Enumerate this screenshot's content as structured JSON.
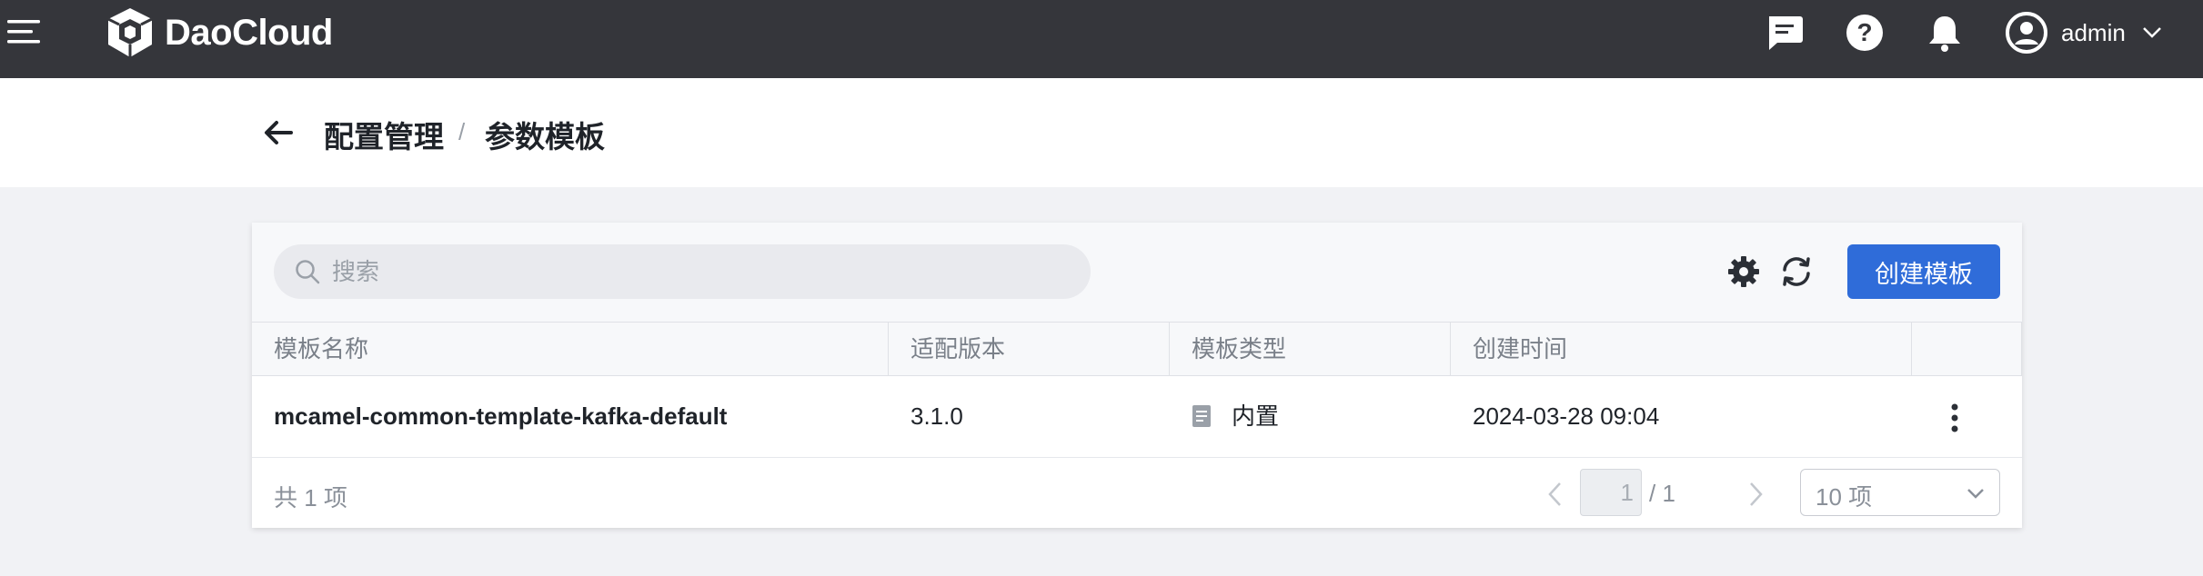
{
  "topbar": {
    "brand": "DaoCloud",
    "user": {
      "name": "admin"
    },
    "icons": [
      "menu-icon",
      "chat-icon",
      "help-icon",
      "bell-icon",
      "user-avatar-icon",
      "chevron-down-icon"
    ]
  },
  "header": {
    "breadcrumb": {
      "parent": "配置管理",
      "separator": "/",
      "current": "参数模板"
    }
  },
  "toolbar": {
    "search_placeholder": "搜索",
    "create_label": "创建模板"
  },
  "table": {
    "columns": [
      "模板名称",
      "适配版本",
      "模板类型",
      "创建时间",
      ""
    ],
    "rows": [
      {
        "name": "mcamel-common-template-kafka-default",
        "version": "3.1.0",
        "type": "内置",
        "created": "2024-03-28 09:04"
      }
    ]
  },
  "pagination": {
    "total_text": "共 1 项",
    "current_page": "1",
    "total_pages_text": "/ 1",
    "page_size": "10 项"
  },
  "colors": {
    "topbar_bg": "#35363b",
    "primary": "#2f6cd9",
    "page_bg": "#f1f2f5"
  }
}
